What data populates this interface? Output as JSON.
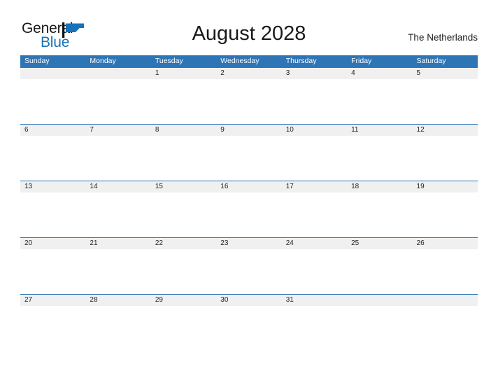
{
  "brand": {
    "name_part_1": "General",
    "name_part_2": "Blue",
    "mark": "triangle-flag-icon",
    "accent_color": "#1872B8"
  },
  "header": {
    "title": "August 2028",
    "location": "The Netherlands"
  },
  "theme": {
    "header_blue": "#2E75B6",
    "band_gray": "#F0F0F0",
    "background": "#FFFFFF",
    "text": "#1A1A1A"
  },
  "calendar": {
    "month": "August",
    "year": "2028",
    "weekday_headers": [
      "Sunday",
      "Monday",
      "Tuesday",
      "Wednesday",
      "Thursday",
      "Friday",
      "Saturday"
    ],
    "weeks": [
      [
        "",
        "",
        "1",
        "2",
        "3",
        "4",
        "5"
      ],
      [
        "6",
        "7",
        "8",
        "9",
        "10",
        "11",
        "12"
      ],
      [
        "13",
        "14",
        "15",
        "16",
        "17",
        "18",
        "19"
      ],
      [
        "20",
        "21",
        "22",
        "23",
        "24",
        "25",
        "26"
      ],
      [
        "27",
        "28",
        "29",
        "30",
        "31",
        "",
        ""
      ]
    ]
  }
}
